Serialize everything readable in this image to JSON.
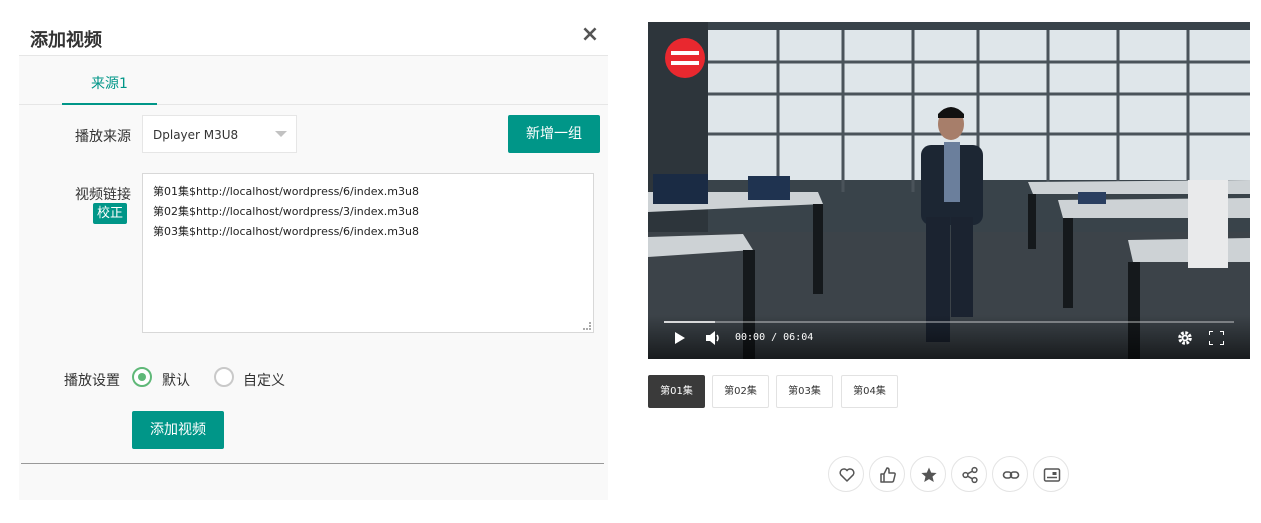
{
  "dialog": {
    "title": "添加视频",
    "close_label": "×",
    "tab_label": "来源1",
    "source_label": "播放来源",
    "source_value": "Dplayer M3U8",
    "add_group_label": "新增一组",
    "links_label": "视频链接",
    "fix_label": "校正",
    "links": [
      "第01集$http://localhost/wordpress/6/index.m3u8",
      "第02集$http://localhost/wordpress/3/index.m3u8",
      "第03集$http://localhost/wordpress/6/index.m3u8"
    ],
    "settings_label": "播放设置",
    "option_default": "默认",
    "option_custom": "自定义",
    "submit_label": "添加视频"
  },
  "player": {
    "time_text": "00:00 / 06:04",
    "progress_buffered": 0.09,
    "accent_color": "#009688"
  },
  "episodes": [
    "第01集",
    "第02集",
    "第03集",
    "第04集"
  ],
  "actions": [
    "heart-icon",
    "thumbs-up-icon",
    "star-icon",
    "share-icon",
    "link-icon",
    "poster-icon"
  ]
}
